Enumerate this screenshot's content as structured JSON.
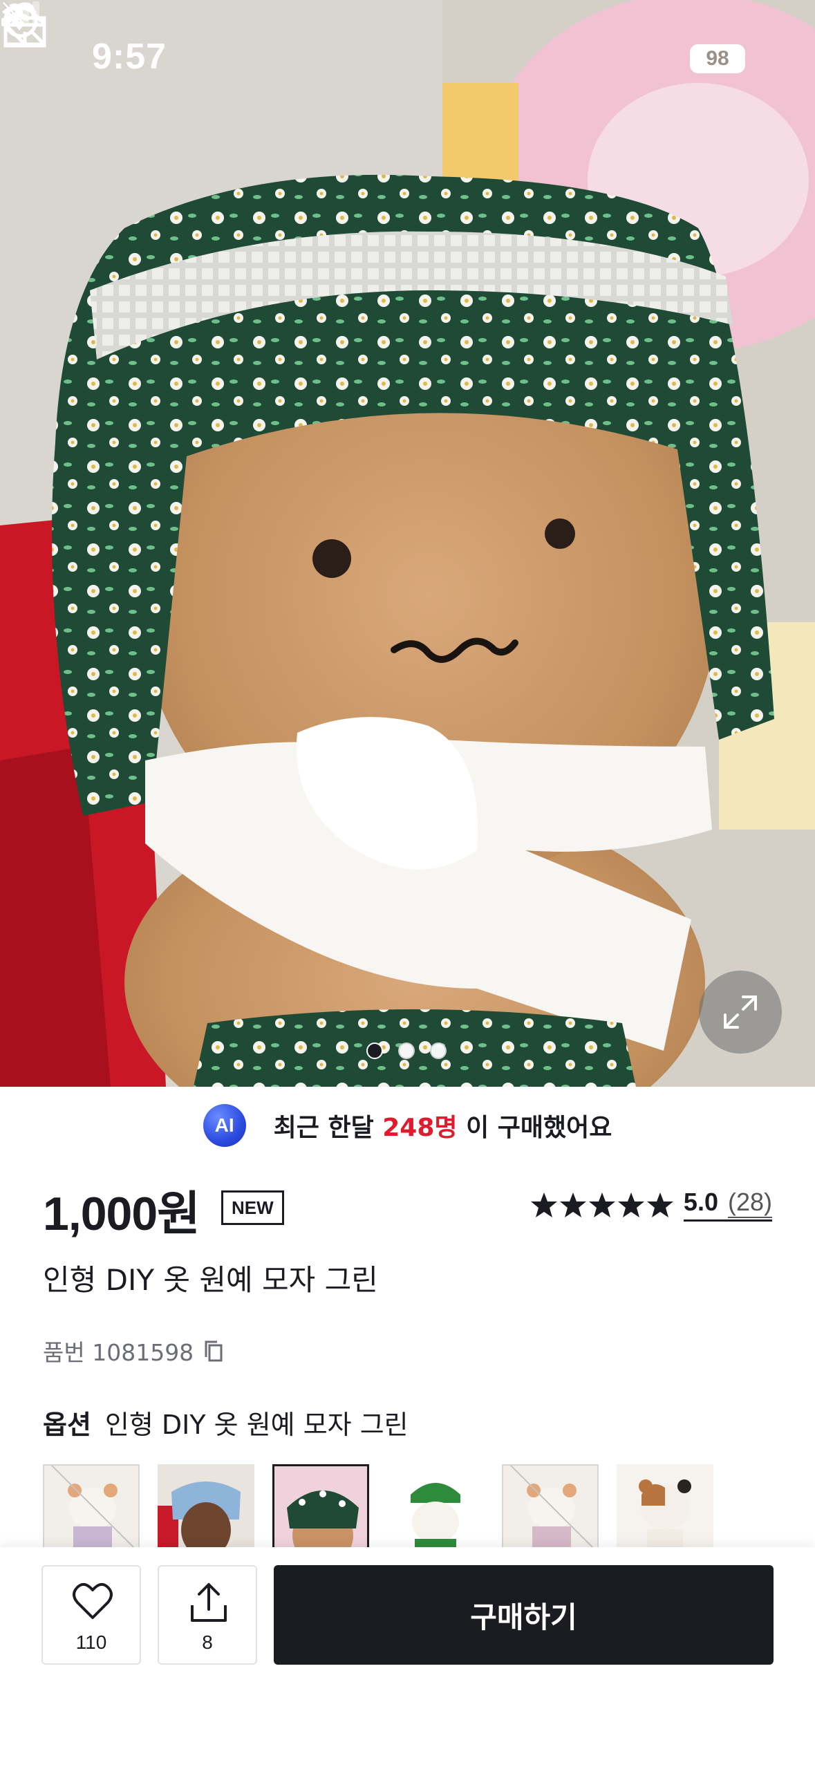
{
  "status_bar": {
    "time": "9:57",
    "battery": "98"
  },
  "hero": {
    "image_dots": 3,
    "active_dot": 0
  },
  "ai_banner": {
    "badge": "AI",
    "text_prefix": "최근 한달",
    "highlight": "248명",
    "text_suffix": "이 구매했어요",
    "highlight_color": "#e01b2d"
  },
  "product": {
    "price": "1,000원",
    "badge": "NEW",
    "rating_score": "5.0",
    "rating_count": "(28)",
    "stars": 5,
    "name": "인형 DIY 옷 원예 모자 그린",
    "sku": "품번 1081598"
  },
  "option": {
    "label": "옵션",
    "value": "인형 DIY 옷 원예 모자 그린"
  },
  "bottom_bar": {
    "like_count": "110",
    "share_count": "8",
    "buy_label": "구매하기"
  },
  "colors": {
    "text": "#1a1c22",
    "accent_red": "#e01b2d",
    "buy_button_bg": "#1a1c22"
  }
}
